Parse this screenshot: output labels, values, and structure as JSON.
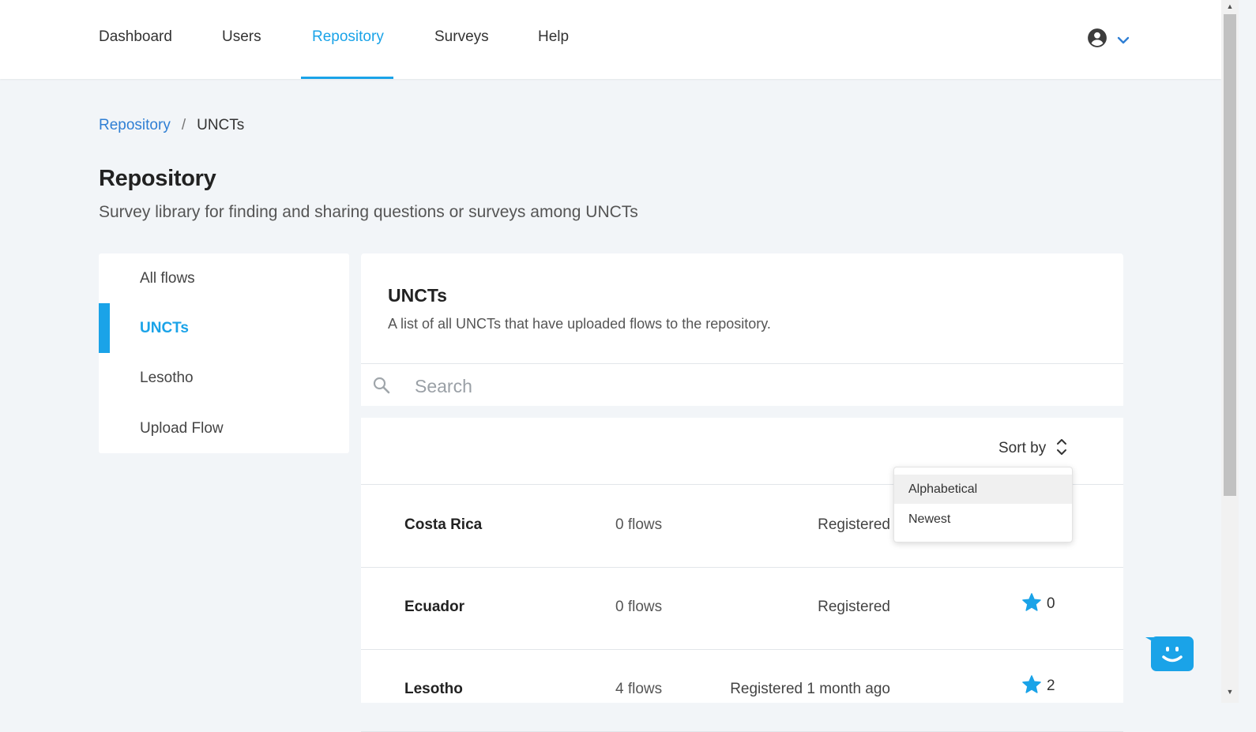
{
  "nav": {
    "items": [
      {
        "label": "Dashboard"
      },
      {
        "label": "Users"
      },
      {
        "label": "Repository"
      },
      {
        "label": "Surveys"
      },
      {
        "label": "Help"
      }
    ],
    "active": "Repository"
  },
  "breadcrumb": {
    "parent": "Repository",
    "separator": "/",
    "current": "UNCTs"
  },
  "page": {
    "title": "Repository",
    "subtitle": "Survey library for finding and sharing questions or surveys among UNCTs"
  },
  "sidebar": {
    "items": [
      {
        "label": "All flows"
      },
      {
        "label": "UNCTs"
      },
      {
        "label": "Lesotho"
      },
      {
        "label": "Upload Flow"
      }
    ],
    "active": "UNCTs"
  },
  "panel": {
    "title": "UNCTs",
    "description": "A list of all UNCTs that have uploaded flows to the repository."
  },
  "search": {
    "placeholder": "Search",
    "value": ""
  },
  "sort": {
    "label": "Sort by",
    "options": [
      "Alphabetical",
      "Newest"
    ],
    "highlighted": "Alphabetical"
  },
  "rows": [
    {
      "name": "Costa Rica",
      "flows": "0 flows",
      "registered": "Registered",
      "stars": ""
    },
    {
      "name": "Ecuador",
      "flows": "0 flows",
      "registered": "Registered",
      "stars": "0"
    },
    {
      "name": "Lesotho",
      "flows": "4 flows",
      "registered": "Registered 1 month ago",
      "stars": "2"
    }
  ],
  "colors": {
    "accent": "#1aa3e8",
    "link": "#2f7fd4",
    "background": "#f2f5f8",
    "star": "#1aa3e8"
  },
  "icons": {
    "account": "account-circle-icon",
    "dropdown": "chevron-down-icon",
    "search": "search-icon",
    "sort": "sort-icon",
    "star": "star-icon",
    "chat": "chat-bot-icon"
  }
}
